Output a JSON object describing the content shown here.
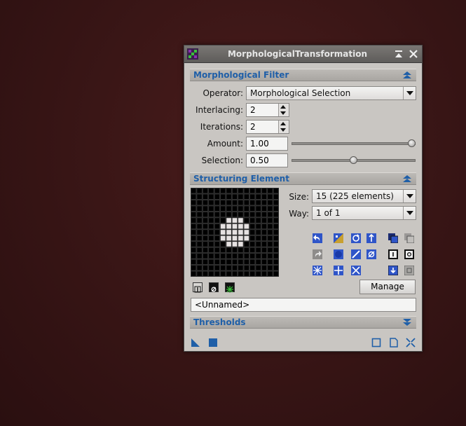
{
  "window": {
    "title": "MorphologicalTransformation"
  },
  "morphological_filter": {
    "header": "Morphological Filter",
    "operator_label": "Operator:",
    "operator_value": "Morphological Selection",
    "interlacing_label": "Interlacing:",
    "interlacing_value": "2",
    "iterations_label": "Iterations:",
    "iterations_value": "2",
    "amount_label": "Amount:",
    "amount_value": "1.00",
    "amount_level": 1.0,
    "selection_label": "Selection:",
    "selection_value": "0.50",
    "selection_level": 0.5
  },
  "structuring_element": {
    "header": "Structuring Element",
    "size_label": "Size:",
    "size_value": "15  (225 elements)",
    "way_label": "Way:",
    "way_value": "1 of 1",
    "manage_label": "Manage",
    "name_value": "<Unnamed>",
    "grid_size": 15,
    "active_cells": [
      [
        5,
        6
      ],
      [
        5,
        7
      ],
      [
        5,
        8
      ],
      [
        6,
        5
      ],
      [
        6,
        6
      ],
      [
        6,
        7
      ],
      [
        6,
        8
      ],
      [
        6,
        9
      ],
      [
        7,
        5
      ],
      [
        7,
        6
      ],
      [
        7,
        7
      ],
      [
        7,
        8
      ],
      [
        7,
        9
      ],
      [
        8,
        5
      ],
      [
        8,
        6
      ],
      [
        8,
        7
      ],
      [
        8,
        8
      ],
      [
        8,
        9
      ],
      [
        9,
        6
      ],
      [
        9,
        7
      ],
      [
        9,
        8
      ]
    ],
    "mini_buttons": [
      "1",
      "0",
      "*"
    ]
  },
  "thresholds": {
    "header": "Thresholds"
  },
  "colors": {
    "accent": "#1f5fa8",
    "tool_blue": "#2f55c8"
  }
}
